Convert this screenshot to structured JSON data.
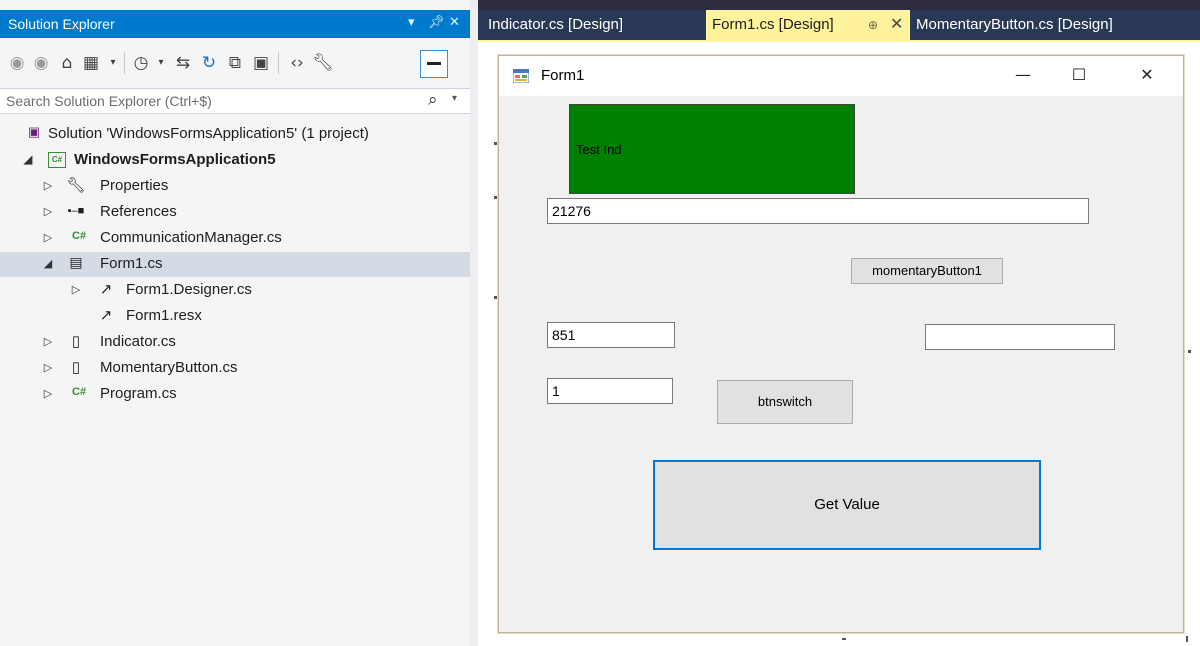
{
  "solution_explorer": {
    "title": "Solution Explorer",
    "header_buttons": {
      "dropdown": "▾",
      "pin": "ᵖ",
      "close": "✕"
    },
    "search": {
      "placeholder": "Search Solution Explorer (Ctrl+$)"
    },
    "tree": [
      {
        "label": "Solution 'WindowsFormsApplication5' (1 project)",
        "icon": "solution-icon"
      },
      {
        "label": "WindowsFormsApplication5",
        "icon": "csharp-project-icon",
        "badge": "C#"
      },
      {
        "label": "Properties",
        "icon": "wrench-icon"
      },
      {
        "label": "References",
        "icon": "references-icon"
      },
      {
        "label": "CommunicationManager.cs",
        "icon": "csharp-file-icon",
        "badge": "C#"
      },
      {
        "label": "Form1.cs",
        "icon": "form-icon"
      },
      {
        "label": "Form1.Designer.cs",
        "icon": "designer-file-icon"
      },
      {
        "label": "Form1.resx",
        "icon": "resx-file-icon"
      },
      {
        "label": "Indicator.cs",
        "icon": "component-file-icon"
      },
      {
        "label": "MomentaryButton.cs",
        "icon": "component-file-icon"
      },
      {
        "label": "Program.cs",
        "icon": "csharp-file-icon",
        "badge": "C#"
      }
    ]
  },
  "document_tabs": [
    {
      "label": "Indicator.cs [Design]",
      "active": false
    },
    {
      "label": "Form1.cs [Design]",
      "active": true
    },
    {
      "label": "MomentaryButton.cs [Design]",
      "active": false
    }
  ],
  "tab_glyphs": {
    "pin": "⊕",
    "close": "✕"
  },
  "form": {
    "title": "Form1",
    "window_buttons": {
      "minimize": "—",
      "maximize": "☐",
      "close": "✕"
    },
    "indicator_label": "Test Ind",
    "indicator_color": "#008000",
    "textbox_top_value": "21276",
    "momentary_button_label": "momentaryButton1",
    "textbox_left_value": "851",
    "textbox_right_value": "",
    "textbox_small_value": "1",
    "btnswitch_label": "btnswitch",
    "get_value_label": "Get Value"
  },
  "colors": {
    "accent": "#007acc",
    "active_tab": "#fff29d",
    "tab_strip": "#293955",
    "focus_border": "#0078d7"
  }
}
